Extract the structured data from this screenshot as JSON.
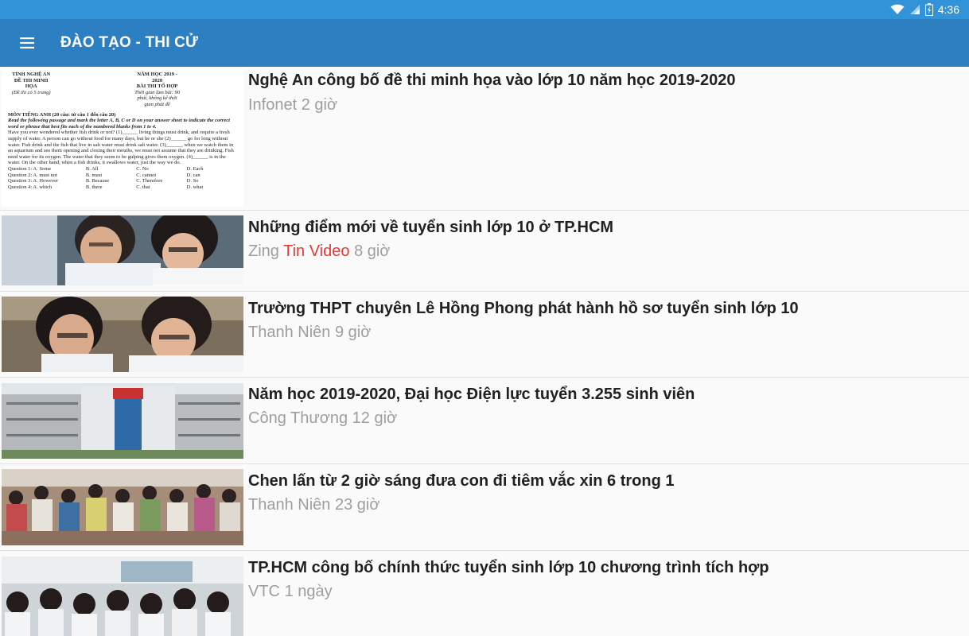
{
  "status_bar": {
    "time": "4:36",
    "icons": [
      "wifi-icon",
      "cell-signal-icon",
      "battery-icon"
    ]
  },
  "app_bar": {
    "menu_icon": "hamburger-menu-icon",
    "title": "ĐÀO TẠO - THI CỬ"
  },
  "articles": [
    {
      "title": "Nghệ An công bố đề thi minh họa vào lớp 10 năm học 2019-2020",
      "source": "Infonet",
      "tag": "",
      "time": "2 giờ"
    },
    {
      "title": "Những điểm mới về tuyển sinh lớp 10 ở TP.HCM",
      "source": "Zing",
      "tag": "Tin Video",
      "time": "8 giờ"
    },
    {
      "title": "Trường THPT chuyên Lê Hồng Phong phát hành hồ sơ tuyển sinh lớp 10",
      "source": "Thanh Niên",
      "tag": "",
      "time": "9 giờ"
    },
    {
      "title": "Năm học 2019-2020, Đại học Điện lực tuyển 3.255 sinh viên",
      "source": "Công Thương",
      "tag": "",
      "time": "12 giờ"
    },
    {
      "title": "Chen lấn từ 2 giờ sáng đưa con đi tiêm vắc xin 6 trong 1",
      "source": "Thanh Niên",
      "tag": "",
      "time": "23 giờ"
    },
    {
      "title": "TP.HCM công bố chính thức tuyển sinh lớp 10 chương trình tích hợp",
      "source": "VTC",
      "tag": "",
      "time": "1 ngày"
    }
  ],
  "doc_thumb": {
    "left_header": "TỈNH NGHỆ AN",
    "left_title": "ĐỀ THI MINH HỌA",
    "left_sub": "(Đề thi có 5 trang)",
    "right_header": "NĂM HỌC 2019 - 2020",
    "right_title": "BÀI THI TỔ HỢP",
    "right_sub": "Thời gian làm bài: 90 phút, không kể thời gian phát đề",
    "section": "MÔN TIẾNG ANH (20 câu: từ câu 1 đến câu 20)",
    "instruction": "Read the following passage and mark the letter A, B, C or D on your answer sheet to indicate the correct word or phrase that best fits each of the numbered blanks from 1 to 4.",
    "passage": "Have you ever wondered whether fish drink or not? (1)______ living things must drink, and require a fresh supply of water. A person can go without food for many days, but he or she (2)______ go for long without water. Fish drink and the fish that live in salt water must drink salt water. (3)______, when we watch them in an aquarium and see them opening and closing their mouths, we must not assume that they are drinking. Fish need water for its oxygen. The water that they seem to be gulping gives them oxygen. (4)______ is in the water. On the other hand, when a fish drinks, it swallows water, just the way we do.",
    "questions": [
      [
        "Question 1: A. Some",
        "B. All",
        "C. No",
        "D. Each"
      ],
      [
        "Question 2: A. must not",
        "B. must",
        "C. cannot",
        "D. can"
      ],
      [
        "Question 3: A. However",
        "B. Because",
        "C. Therefore",
        "D. So"
      ],
      [
        "Question 4: A. which",
        "B. there",
        "C. that",
        "D. what"
      ]
    ]
  }
}
